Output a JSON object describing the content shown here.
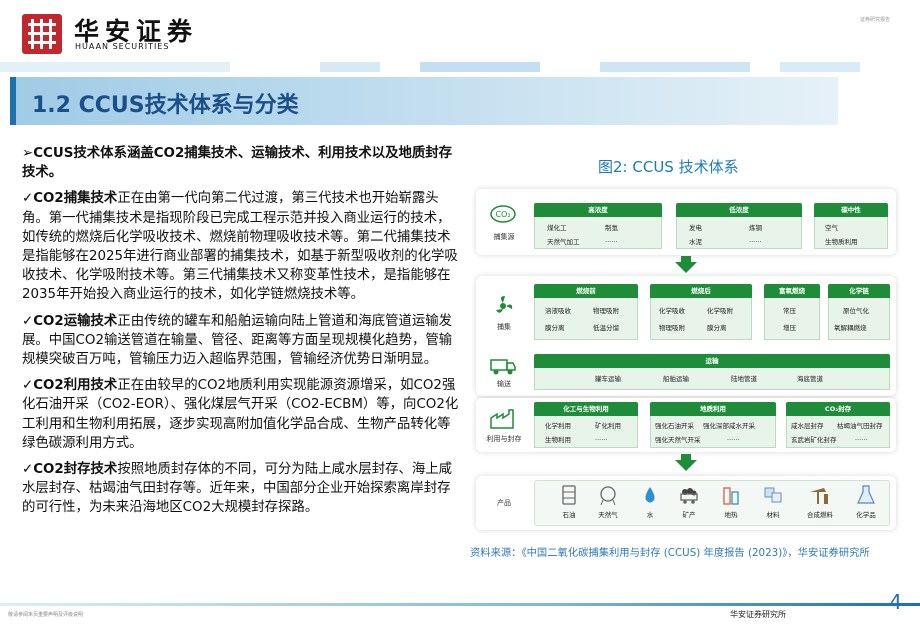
{
  "header": {
    "company_cn": "华安证券",
    "company_en": "HUAAN SECURITIES",
    "top_right_note": "证券研究报告"
  },
  "title": "1.2 CCUS技术体系与分类",
  "left": {
    "intro": "➢CCUS技术体系涵盖CO2捕集技术、运输技术、利用技术以及地质封存技术。",
    "paragraphs": [
      {
        "lead": "✓CO2捕集技术",
        "text": "正在由第一代向第二代过渡，第三代技术也开始崭露头角。第一代捕集技术是指现阶段已完成工程示范并投入商业运行的技术，如传统的燃烧后化学吸收技术、燃烧前物理吸收技术等。第二代捕集技术是指能够在2025年进行商业部署的捕集技术，如基于新型吸收剂的化学吸收技术、化学吸附技术等。第三代捕集技术又称变革性技术，是指能够在2035年开始投入商业运行的技术，如化学链燃烧技术等。"
      },
      {
        "lead": "✓CO2运输技术",
        "text": "正由传统的罐车和船舶运输向陆上管道和海底管道运输发展。中国CO2输送管道在输量、管径、距离等方面呈现规模化趋势，管输规模突破百万吨，管输压力迈入超临界范围，管输经济优势日渐明显。"
      },
      {
        "lead": "✓CO2利用技术",
        "text": "正在由较早的CO2地质利用实现能源资源增采，如CO2强化石油开采（CO2-EOR）、强化煤层气开采（CO2-ECBM）等，向CO2化工利用和生物利用拓展，逐步实现高附加值化学品合成、生物产品转化等绿色碳源利用方式。"
      },
      {
        "lead": "✓CO2封存技术",
        "text": "按照地质封存体的不同，可分为陆上咸水层封存、海上咸水层封存、枯竭油气田封存等。近年来，中国部分企业开始探索离岸封存的可行性，为未来沿海地区CO2大规模封存探路。"
      }
    ]
  },
  "figure": {
    "title": "图2:  CCUS 技术体系",
    "sources": {
      "label": "捕集源",
      "groups": [
        {
          "head": "高浓度",
          "items": [
            "煤化工",
            "制氢",
            "天然气加工",
            "......"
          ]
        },
        {
          "head": "低浓度",
          "items": [
            "发电",
            "炼钢",
            "水泥",
            "......"
          ]
        },
        {
          "head": "碳中性",
          "items": [
            "空气",
            "生物质利用"
          ]
        }
      ]
    },
    "capture": {
      "label": "捕集",
      "groups": [
        {
          "head": "燃烧前",
          "items": [
            "溶液吸收",
            "物理吸附",
            "膜分离",
            "低温分馏"
          ]
        },
        {
          "head": "燃烧后",
          "items": [
            "化学吸收",
            "化学吸附",
            "物理吸附",
            "膜分离"
          ]
        },
        {
          "head": "富氧燃烧",
          "items": [
            "常压",
            "增压"
          ]
        },
        {
          "head": "化学链",
          "items": [
            "原位气化",
            "氧解耦燃烧"
          ]
        }
      ]
    },
    "transport": {
      "label": "输送",
      "head": "运输",
      "items": [
        "罐车运输",
        "船舶运输",
        "陆地管道",
        "海底管道"
      ]
    },
    "use": {
      "label": "利用与封存",
      "groups": [
        {
          "head": "化工与生物利用",
          "items": [
            "化学利用",
            "矿化利用",
            "生物利用",
            "......"
          ]
        },
        {
          "head": "地质利用",
          "items": [
            "强化石油开采",
            "强化深部咸水开采",
            "强化天然气开采",
            "......"
          ]
        },
        {
          "head": "CO₂封存",
          "items": [
            "咸水层封存",
            "枯竭油气田封存",
            "玄武岩矿化封存",
            "......"
          ]
        }
      ]
    },
    "products": {
      "label": "产品",
      "items": [
        "石油",
        "天然气",
        "水",
        "矿产",
        "地热",
        "材料",
        "合成燃料",
        "化学品"
      ]
    }
  },
  "source_note": "资料来源：《中国二氧化碳捕集利用与封存 (CCUS) 年度报告 (2023)》，华安证券研究所",
  "footer": {
    "left_note": "敬请参阅末页重要声明及评级说明",
    "right_label": "华安证券研究所",
    "page_number": "4"
  },
  "colors": {
    "accent_green": "#1f8c3a",
    "title_blue": "#1b4f8a",
    "link_blue": "#2f79b9",
    "brand_red": "#c0282e"
  }
}
